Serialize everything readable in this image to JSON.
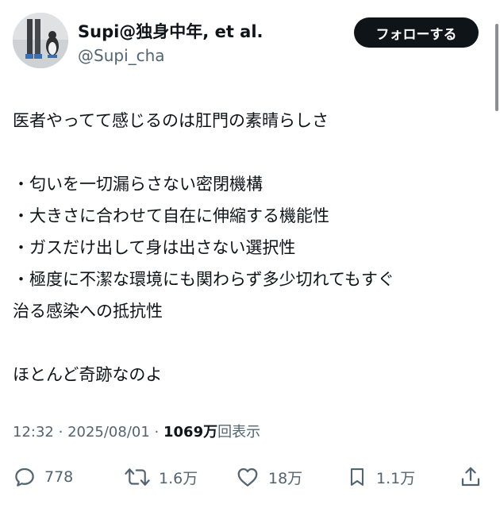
{
  "post": {
    "display_name": "Supi@独身中年, et al.",
    "handle": "@Supi_cha",
    "follow_label": "フォローする",
    "lines": [
      "医者やってて感じるのは肛門の素晴らしさ",
      "",
      "・匂いを一切漏らさない密閉機構",
      "・大きさに合わせて自在に伸縮する機能性",
      "・ガスだけ出して身は出さない選択性",
      "・極度に不潔な環境にも関わらず多少切れてもすぐ",
      "治る感染への抵抗性",
      "",
      "ほとんど奇跡なのよ"
    ],
    "time": "12:32",
    "date": "2025/08/01",
    "views_count": "1069万",
    "views_label": "回表示"
  },
  "actions": {
    "reply": "778",
    "repost": "1.6万",
    "like": "18万",
    "bookmark": "1.1万"
  },
  "icons": {
    "reply": "reply-icon",
    "repost": "repost-icon",
    "like": "heart-icon",
    "bookmark": "bookmark-icon",
    "share": "share-icon"
  }
}
